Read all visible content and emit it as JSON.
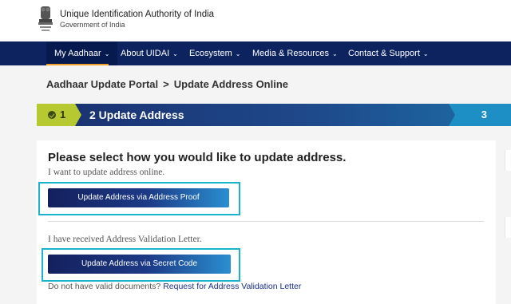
{
  "header": {
    "org_name": "Unique Identification Authority of India",
    "gov": "Government of India",
    "emblem": "national-emblem-icon"
  },
  "nav": {
    "items": [
      {
        "label": "My Aadhaar"
      },
      {
        "label": "About UIDAI"
      },
      {
        "label": "Ecosystem"
      },
      {
        "label": "Media & Resources"
      },
      {
        "label": "Contact & Support"
      }
    ],
    "chevron": "⌄"
  },
  "breadcrumb": {
    "portal": "Aadhaar Update Portal",
    "separator": ">",
    "page": "Update Address Online"
  },
  "steps": {
    "step1": "1",
    "step2_label": "2 Update Address",
    "step3": "3"
  },
  "card": {
    "title": "Please select how you would like to update address.",
    "online_text": "I want to update address online.",
    "proof_button": "Update Address via Address Proof",
    "letter_text": "I have received Address Validation Letter.",
    "secret_button": "Update Address via Secret Code",
    "footnote_prefix": "Do not have valid documents?",
    "footnote_link": "Request for Address Validation Letter"
  },
  "colors": {
    "nav_bg": "#0d2360",
    "step_active": "#b7c930",
    "highlight": "#19b3cc",
    "link": "#1a2f8a"
  }
}
